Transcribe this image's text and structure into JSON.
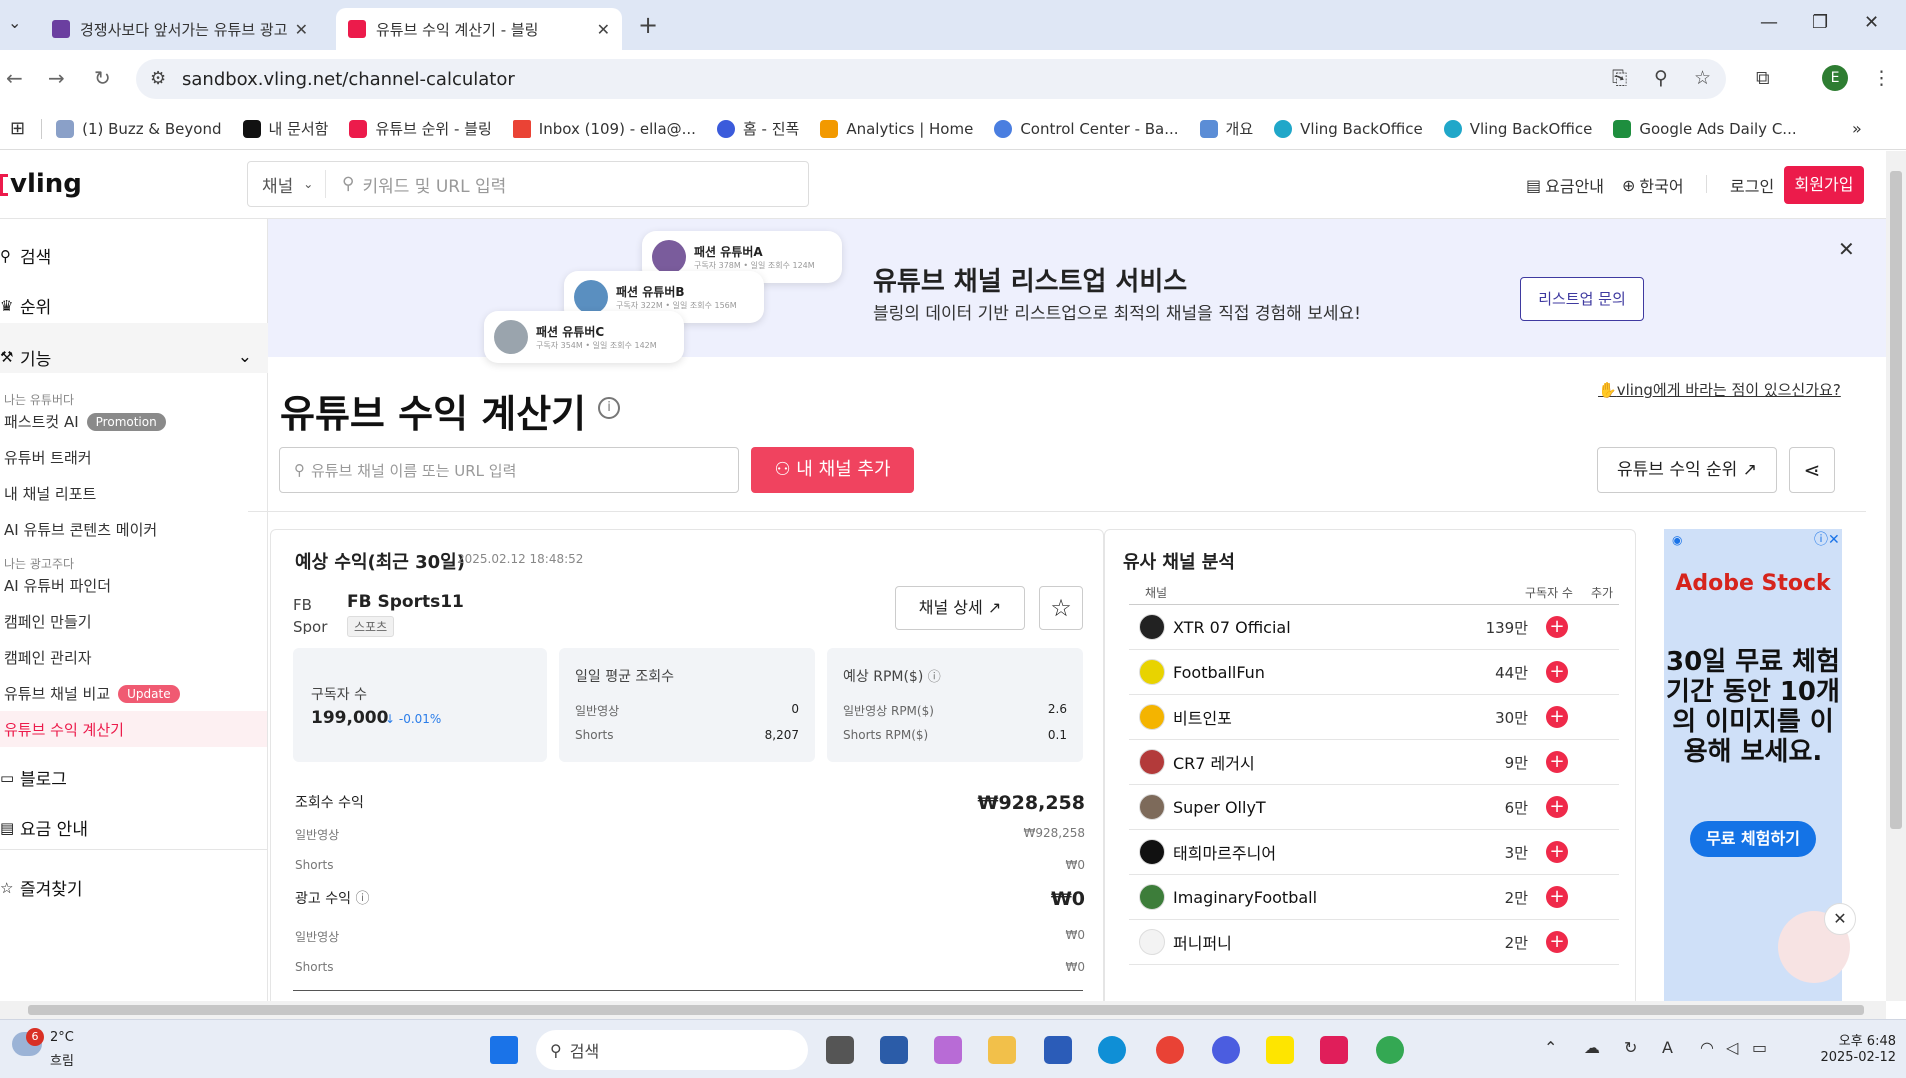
{
  "browser": {
    "tabs": [
      {
        "title": "경쟁사보다 앞서가는 유튜브 광고"
      },
      {
        "title": "유튜브 수익 계산기 - 블링"
      }
    ],
    "url": "sandbox.vling.net/channel-calculator",
    "profile_initial": "E",
    "bookmarks": [
      "(1) Buzz & Beyond",
      "내 문서함",
      "유튜브 순위 - 블링",
      "Inbox (109) - ella@...",
      "홈 - 진폭",
      "Analytics | Home",
      "Control Center - Ba...",
      "개요",
      "Vling BackOffice",
      "Vling BackOffice",
      "Google Ads Daily C..."
    ]
  },
  "header": {
    "logo": "vling",
    "search_select": "채널",
    "search_placeholder": "키워드 및 URL 입력",
    "pricing": "요금안내",
    "language": "한국어",
    "login": "로그인",
    "signup": "회원가입"
  },
  "sidebar": {
    "search": "검색",
    "ranking": "순위",
    "features": "기능",
    "youtuber_caption": "나는 유튜버다",
    "fastcut": "패스트컷 AI",
    "promotion_badge": "Promotion",
    "tracker": "유튜버 트래커",
    "report": "내 채널 리포트",
    "content_maker": "AI 유튜브 콘텐츠 메이커",
    "advertiser_caption": "나는 광고주다",
    "finder": "AI 유튜버 파인더",
    "campaign_create": "캠페인 만들기",
    "campaign_manage": "캠페인 관리자",
    "compare": "유튜브 채널 비교",
    "update_badge": "Update",
    "calculator": "유튜브 수익 계산기",
    "blog": "블로그",
    "pricing": "요금 안내",
    "favorites": "즐겨찾기"
  },
  "banner": {
    "chips": [
      {
        "name": "패션 유튜버A",
        "meta": "구독자 378M • 일일 조회수 124M"
      },
      {
        "name": "패션 유튜버B",
        "meta": "구독자 322M • 일일 조회수 156M"
      },
      {
        "name": "패션 유튜버C",
        "meta": "구독자 354M • 일일 조회수 142M"
      }
    ],
    "title": "유튜브 채널 리스트업 서비스",
    "desc": "블링의 데이터 기반 리스트업으로 최적의 채널을 직접 경험해 보세요!",
    "button": "리스트업 문의"
  },
  "page": {
    "title": "유튜브 수익 계산기",
    "feedback": "vling에게 바라는 점이 있으신가요?",
    "channel_search_placeholder": "유튜브 채널 이름 또는 URL 입력",
    "add_channel": "내 채널 추가",
    "rank_button": "유튜브 수익 순위"
  },
  "revenue": {
    "title": "예상 수익(최근 30일)",
    "timestamp": "2025.02.12 18:48:52",
    "channel_thumb_alt": "FB Spor",
    "channel_name": "FB Sports11",
    "channel_tag": "스포츠",
    "detail_button": "채널 상세",
    "subs_label": "구독자 수",
    "subs_value": "199,000",
    "subs_change": "↓ -0.01%",
    "daily_label": "일일 평균 조회수",
    "daily_normal_label": "일반영상",
    "daily_normal_value": "0",
    "daily_shorts_label": "Shorts",
    "daily_shorts_value": "8,207",
    "rpm_label": "예상 RPM($)",
    "rpm_normal_label": "일반영상 RPM($)",
    "rpm_normal_value": "2.6",
    "rpm_shorts_label": "Shorts RPM($)",
    "rpm_shorts_value": "0.1",
    "view_rev_label": "조회수 수익",
    "view_rev_value": "₩928,258",
    "view_normal_label": "일반영상",
    "view_normal_value": "₩928,258",
    "view_shorts_label": "Shorts",
    "view_shorts_value": "₩0",
    "ad_rev_label": "광고 수익",
    "ad_rev_value": "₩0",
    "ad_normal_label": "일반영상",
    "ad_normal_value": "₩0",
    "ad_shorts_label": "Shorts",
    "ad_shorts_value": "₩0"
  },
  "similar": {
    "title": "유사 채널 분석",
    "col_channel": "채널",
    "col_subs": "구독자 수",
    "col_add": "추가",
    "rows": [
      {
        "name": "XTR 07 Official",
        "subs": "139만"
      },
      {
        "name": "FootballFun",
        "subs": "44만"
      },
      {
        "name": "비트인포",
        "subs": "30만"
      },
      {
        "name": "CR7 레거시",
        "subs": "9만"
      },
      {
        "name": "Super OllyT",
        "subs": "6만"
      },
      {
        "name": "태희마르주니어",
        "subs": "3만"
      },
      {
        "name": "ImaginaryFootball",
        "subs": "2만"
      },
      {
        "name": "퍼니퍼니",
        "subs": "2만"
      }
    ]
  },
  "ad": {
    "brand": "Adobe Stock",
    "message": "30일 무료 체험 기간 동안 10개의 이미지를 이용해 보세요.",
    "cta": "무료 체험하기"
  },
  "taskbar": {
    "weather_badge": "6",
    "temp": "2°C",
    "condition": "흐림",
    "search": "검색",
    "time": "오후 6:48",
    "date": "2025-02-12"
  },
  "colors": {
    "accent": "#ec1b4b",
    "add_button": "#f0435f",
    "banner_bg": "#eef0fd",
    "active_nav_bg": "#fdf0f2"
  }
}
